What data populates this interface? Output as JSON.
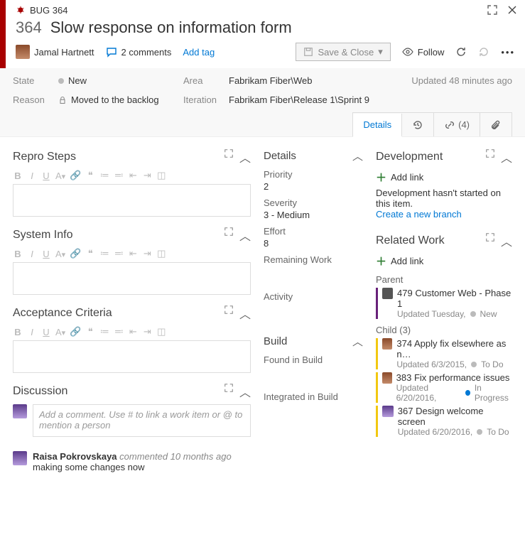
{
  "window": {
    "type_label": "BUG 364"
  },
  "header": {
    "id": "364",
    "title": "Slow response on information form",
    "assignee": "Jamal Hartnett",
    "comments": "2 comments",
    "add_tag": "Add tag",
    "save_close": "Save & Close",
    "follow": "Follow"
  },
  "meta": {
    "state_label": "State",
    "state": "New",
    "reason_label": "Reason",
    "reason": "Moved to the backlog",
    "area_label": "Area",
    "area": "Fabrikam Fiber\\Web",
    "iteration_label": "Iteration",
    "iteration": "Fabrikam Fiber\\Release 1\\Sprint 9",
    "updated": "Updated 48 minutes ago"
  },
  "tabs": {
    "details": "Details",
    "links_count": "(4)"
  },
  "left": {
    "repro": "Repro Steps",
    "system_info": "System Info",
    "acceptance": "Acceptance Criteria",
    "discussion": "Discussion",
    "comment_placeholder": "Add a comment. Use # to link a work item or @ to mention a person",
    "c1_author": "Raisa Pokrovskaya",
    "c1_meta": "commented 10 months ago",
    "c1_body": "making some changes now"
  },
  "details": {
    "title": "Details",
    "priority_l": "Priority",
    "priority_v": "2",
    "severity_l": "Severity",
    "severity_v": "3 - Medium",
    "effort_l": "Effort",
    "effort_v": "8",
    "remaining_l": "Remaining Work",
    "activity_l": "Activity",
    "build_title": "Build",
    "found_l": "Found in Build",
    "integrated_l": "Integrated in Build"
  },
  "dev": {
    "title": "Development",
    "add_link": "Add link",
    "not_started": "Development hasn't started on this item.",
    "create_branch": "Create a new branch"
  },
  "related": {
    "title": "Related Work",
    "add_link": "Add link",
    "parent_label": "Parent",
    "parent_id": "479",
    "parent_title": "Customer Web - Phase 1",
    "parent_sub": "Updated Tuesday,",
    "parent_state": "New",
    "child_label": "Child (3)",
    "c1_id": "374",
    "c1_title": "Apply fix elsewhere as n…",
    "c1_sub": "Updated 6/3/2015,",
    "c1_state": "To Do",
    "c2_id": "383",
    "c2_title": "Fix performance issues",
    "c2_sub": "Updated 6/20/2016,",
    "c2_state": "In Progress",
    "c3_id": "367",
    "c3_title": "Design welcome screen",
    "c3_sub": "Updated 6/20/2016,",
    "c3_state": "To Do"
  }
}
